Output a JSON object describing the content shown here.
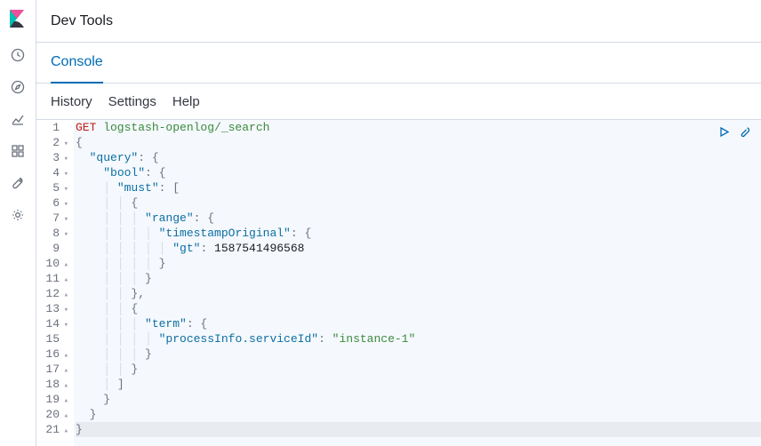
{
  "header": {
    "title": "Dev Tools"
  },
  "tabs": {
    "console": "Console"
  },
  "toolbar": {
    "history": "History",
    "settings": "Settings",
    "help": "Help"
  },
  "request": {
    "method": "GET",
    "path": "logstash-openlog/_search",
    "body": {
      "query": {
        "bool": {
          "must": [
            {
              "range": {
                "timestampOriginal": {
                  "gt": 1587541496568
                }
              }
            },
            {
              "term": {
                "processInfo.serviceId": "instance-1"
              }
            }
          ]
        }
      }
    }
  },
  "code": {
    "l1_method": "GET",
    "l1_path": " logstash-openlog/_search",
    "l2": "{",
    "l3_k": "\"query\"",
    "l3_r": ": {",
    "l4_k": "\"bool\"",
    "l4_r": ": {",
    "l5_k": "\"must\"",
    "l5_r": ": [",
    "l6": "{",
    "l7_k": "\"range\"",
    "l7_r": ": {",
    "l8_k": "\"timestampOriginal\"",
    "l8_r": ": {",
    "l9_k": "\"gt\"",
    "l9_c": ": ",
    "l9_v": "1587541496568",
    "l10": "}",
    "l11": "}",
    "l12": "},",
    "l13": "{",
    "l14_k": "\"term\"",
    "l14_r": ": {",
    "l15_k": "\"processInfo.serviceId\"",
    "l15_c": ": ",
    "l15_v": "\"instance-1\"",
    "l16": "}",
    "l17": "}",
    "l18": "]",
    "l19": "}",
    "l20": "}",
    "l21": "}"
  },
  "lines": [
    {
      "n": "1",
      "f": ""
    },
    {
      "n": "2",
      "f": "▾"
    },
    {
      "n": "3",
      "f": "▾"
    },
    {
      "n": "4",
      "f": "▾"
    },
    {
      "n": "5",
      "f": "▾"
    },
    {
      "n": "6",
      "f": "▾"
    },
    {
      "n": "7",
      "f": "▾"
    },
    {
      "n": "8",
      "f": "▾"
    },
    {
      "n": "9",
      "f": ""
    },
    {
      "n": "10",
      "f": "▴"
    },
    {
      "n": "11",
      "f": "▴"
    },
    {
      "n": "12",
      "f": "▴"
    },
    {
      "n": "13",
      "f": "▾"
    },
    {
      "n": "14",
      "f": "▾"
    },
    {
      "n": "15",
      "f": ""
    },
    {
      "n": "16",
      "f": "▴"
    },
    {
      "n": "17",
      "f": "▴"
    },
    {
      "n": "18",
      "f": "▴"
    },
    {
      "n": "19",
      "f": "▴"
    },
    {
      "n": "20",
      "f": "▴"
    },
    {
      "n": "21",
      "f": "▴"
    }
  ]
}
